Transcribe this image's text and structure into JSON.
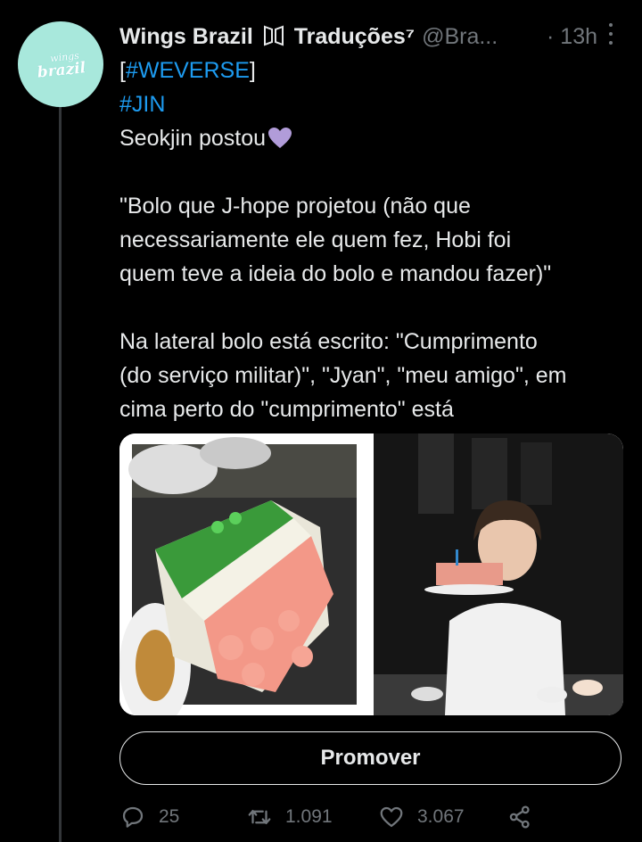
{
  "tweet": {
    "author_name": "Wings Brazil",
    "author_suffix": "Traduções⁷",
    "handle": "@Bra...",
    "time": "· 13h",
    "avatar": {
      "logo_top": "wings",
      "logo_bottom": "brazil"
    },
    "lines": [
      {
        "text": "[",
        "tag": "#WEVERSE",
        "after": "]"
      },
      {
        "tag": "#JIN"
      },
      {
        "text": "Seokjin postou"
      },
      {
        "text": ""
      },
      {
        "text": "\"Bolo que J-hope projetou (não que"
      },
      {
        "text": "necessariamente ele quem fez, Hobi foi"
      },
      {
        "text": "quem teve a ideia do bolo e mandou fazer)\""
      },
      {
        "text": ""
      },
      {
        "text": "Na lateral bolo está escrito: \"Cumprimento"
      },
      {
        "text": "(do serviço militar)\", \"Jyan\", \"meu amigo\", em"
      },
      {
        "text": "cima perto do \"cumprimento\" está"
      }
    ],
    "promote_label": "Promover",
    "stats": {
      "replies": "25",
      "retweets": "1.091",
      "likes": "3.067"
    }
  },
  "colors": {
    "link": "#1d9bf0",
    "muted": "#71767b",
    "heart_emoji": "#b19cd9"
  },
  "icons": [
    "more-icon",
    "purple-heart-icon",
    "reply-icon",
    "retweet-icon",
    "like-icon",
    "share-icon"
  ]
}
